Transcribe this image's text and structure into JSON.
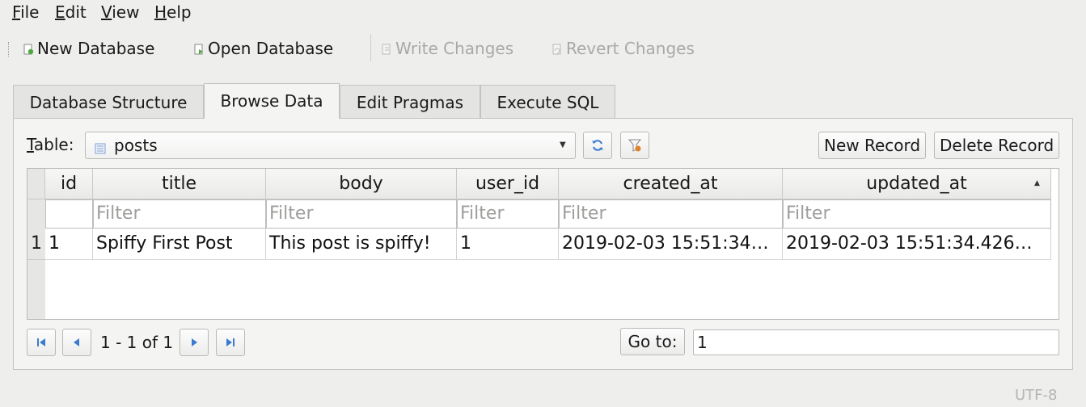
{
  "menu": [
    {
      "key": "F",
      "rest": "ile"
    },
    {
      "key": "E",
      "rest": "dit"
    },
    {
      "key": "V",
      "rest": "iew"
    },
    {
      "key": "H",
      "rest": "elp"
    }
  ],
  "toolbar": {
    "new_database": "New Database",
    "open_database": "Open Database",
    "write_changes": "Write Changes",
    "revert_changes": "Revert Changes"
  },
  "tabs": [
    "Database Structure",
    "Browse Data",
    "Edit Pragmas",
    "Execute SQL"
  ],
  "active_tab": "Browse Data",
  "browse": {
    "table_label_key": "T",
    "table_label_rest": "able:",
    "selected_table": "posts",
    "new_record": "New Record",
    "delete_record": "Delete Record"
  },
  "grid": {
    "columns": [
      "id",
      "title",
      "body",
      "user_id",
      "created_at",
      "updated_at"
    ],
    "filter_placeholder": "Filter",
    "rows": [
      {
        "row_number": "1",
        "cells": [
          "1",
          "Spiffy First Post",
          "This post is spiffy!",
          "1",
          "2019-02-03 15:51:34…",
          "2019-02-03 15:51:34.426…"
        ]
      }
    ],
    "sort_indicator": "▲"
  },
  "pagination": {
    "range_text": "1 - 1 of 1",
    "goto_label": "Go to:",
    "goto_value": "1"
  },
  "status_bar": {
    "encoding": "UTF-8"
  },
  "icons": {
    "first": "first-page-icon",
    "prev": "previous-page-icon",
    "next": "next-page-icon",
    "last": "last-page-icon",
    "refresh": "refresh-icon",
    "clear_filters": "clear-filters-icon"
  },
  "colors": {
    "icon_blue": "#3a7ad0",
    "disabled_text": "#a9a9a7"
  }
}
